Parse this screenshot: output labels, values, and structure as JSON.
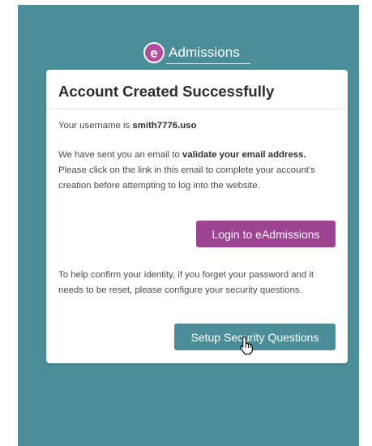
{
  "brand": {
    "logo_letter": "e",
    "logo_name": "Admissions",
    "logo_color": "#b24c9c",
    "background_color": "#4b8e99"
  },
  "card": {
    "title": "Account Created Successfully",
    "username_prefix": "Your username is ",
    "username": "smith7776.uso",
    "email_text_1": "We have sent you an email to ",
    "email_bold": "validate your email address.",
    "email_text_2": " Please click on the link in this email to complete your account's creation before attempting to log into the website.",
    "security_text": "To help confirm your identity, if you forget your password and it needs to be reset, please configure your security questions."
  },
  "buttons": {
    "login_label": "Login to eAdmissions",
    "login_color": "#9c4391",
    "security_label": "Setup Security Questions",
    "security_color": "#4b8e99"
  },
  "cursor": {
    "icon": "hand-pointer-icon"
  }
}
